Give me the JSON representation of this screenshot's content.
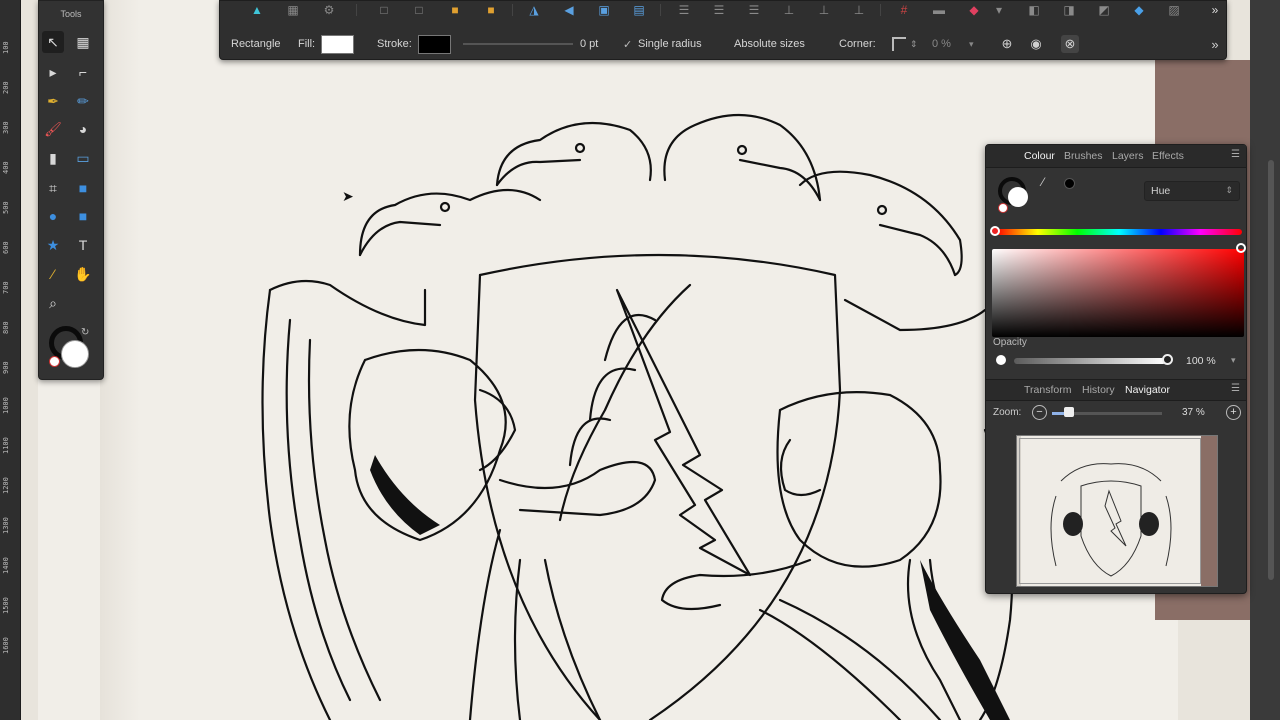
{
  "tools_panel": {
    "title": "Tools",
    "tools": [
      {
        "icon": "move-tool-icon"
      },
      {
        "icon": "artboard-tool-icon"
      },
      {
        "icon": "node-tool-icon"
      },
      {
        "icon": "corner-tool-icon"
      },
      {
        "icon": "pen-tool-icon"
      },
      {
        "icon": "pencil-tool-icon"
      },
      {
        "icon": "vector-brush-tool-icon"
      },
      {
        "icon": "fill-tool-icon"
      },
      {
        "icon": "transparency-tool-icon"
      },
      {
        "icon": "place-image-tool-icon"
      },
      {
        "icon": "crop-tool-icon"
      },
      {
        "icon": "rectangle-tool-icon"
      },
      {
        "icon": "ellipse-tool-icon"
      },
      {
        "icon": "rounded-rectangle-tool-icon"
      },
      {
        "icon": "triangle-tool-icon"
      },
      {
        "icon": "artistic-text-tool-icon"
      },
      {
        "icon": "color-picker-tool-icon"
      },
      {
        "icon": "view-tool-icon"
      },
      {
        "icon": "zoom-tool-icon"
      }
    ]
  },
  "context_toolbar": {
    "shape_name": "Rectangle",
    "fill_label": "Fill:",
    "stroke_label": "Stroke:",
    "stroke_width": "0 pt",
    "single_radius": "Single radius",
    "single_radius_checked": true,
    "absolute_sizes": "Absolute sizes",
    "corner_label": "Corner:",
    "corner_value": "0 %"
  },
  "studio": {
    "tabs": [
      "Colour",
      "Brushes",
      "Layers",
      "Effects"
    ],
    "active_tab": "Colour",
    "colour_model": "Hue",
    "opacity_label": "Opacity",
    "opacity_value": "100 %",
    "tabs2": [
      "Transform",
      "History",
      "Navigator"
    ],
    "active_tab2": "Navigator",
    "zoom_label": "Zoom:",
    "zoom_value": "37 %"
  },
  "ruler_labels": [
    "100",
    "200",
    "300",
    "400",
    "500",
    "600",
    "700",
    "800",
    "900",
    "1000",
    "1100",
    "1200",
    "1300",
    "1400",
    "1500",
    "1600"
  ]
}
